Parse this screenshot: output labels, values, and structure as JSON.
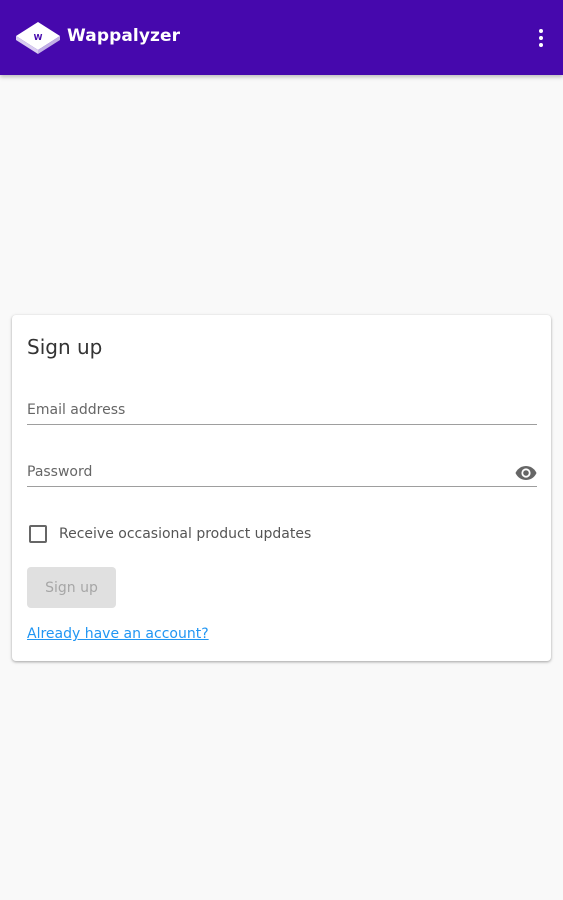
{
  "app_bar": {
    "title": "Wappalyzer",
    "background_color": "#4608ad",
    "logo_icon": "wappalyzer-logo-icon",
    "menu_icon": "more-vert-icon"
  },
  "signup_card": {
    "title": "Sign up",
    "email_field": {
      "placeholder": "Email address",
      "value": ""
    },
    "password_field": {
      "placeholder": "Password",
      "value": "",
      "toggle_icon": "eye-icon"
    },
    "updates_checkbox": {
      "label": "Receive occasional product updates",
      "checked": false
    },
    "submit_button": {
      "label": "Sign up",
      "disabled": true
    },
    "login_link": {
      "label": "Already have an account?",
      "color": "#2196f3"
    }
  }
}
